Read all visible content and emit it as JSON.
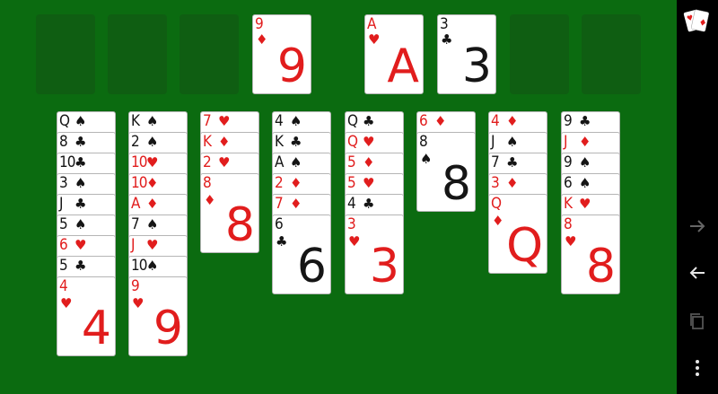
{
  "board": {
    "free_cells": 4,
    "foundations": [
      {
        "rank": "A",
        "suit": "♥",
        "color": "red"
      },
      {
        "rank": "3",
        "suit": "♣",
        "color": "black"
      }
    ],
    "top_card": {
      "rank": "9",
      "suit": "♦",
      "color": "red"
    },
    "tableau": [
      [
        {
          "rank": "Q",
          "suit": "♠",
          "color": "black"
        },
        {
          "rank": "8",
          "suit": "♣",
          "color": "black"
        },
        {
          "rank": "10",
          "suit": "♣",
          "color": "black"
        },
        {
          "rank": "3",
          "suit": "♠",
          "color": "black"
        },
        {
          "rank": "J",
          "suit": "♣",
          "color": "black"
        },
        {
          "rank": "5",
          "suit": "♠",
          "color": "black"
        },
        {
          "rank": "6",
          "suit": "♥",
          "color": "red"
        },
        {
          "rank": "5",
          "suit": "♣",
          "color": "black"
        },
        {
          "rank": "4",
          "suit": "♥",
          "color": "red"
        }
      ],
      [
        {
          "rank": "K",
          "suit": "♠",
          "color": "black"
        },
        {
          "rank": "2",
          "suit": "♠",
          "color": "black"
        },
        {
          "rank": "10",
          "suit": "♥",
          "color": "red"
        },
        {
          "rank": "10",
          "suit": "♦",
          "color": "red"
        },
        {
          "rank": "A",
          "suit": "♦",
          "color": "red"
        },
        {
          "rank": "7",
          "suit": "♠",
          "color": "black"
        },
        {
          "rank": "J",
          "suit": "♥",
          "color": "red"
        },
        {
          "rank": "10",
          "suit": "♠",
          "color": "black"
        },
        {
          "rank": "9",
          "suit": "♥",
          "color": "red"
        }
      ],
      [
        {
          "rank": "7",
          "suit": "♥",
          "color": "red"
        },
        {
          "rank": "K",
          "suit": "♦",
          "color": "red"
        },
        {
          "rank": "2",
          "suit": "♥",
          "color": "red"
        },
        {
          "rank": "8",
          "suit": "♦",
          "color": "red"
        }
      ],
      [
        {
          "rank": "4",
          "suit": "♠",
          "color": "black"
        },
        {
          "rank": "K",
          "suit": "♣",
          "color": "black"
        },
        {
          "rank": "A",
          "suit": "♠",
          "color": "black"
        },
        {
          "rank": "2",
          "suit": "♦",
          "color": "red"
        },
        {
          "rank": "7",
          "suit": "♦",
          "color": "red"
        },
        {
          "rank": "6",
          "suit": "♣",
          "color": "black"
        }
      ],
      [
        {
          "rank": "Q",
          "suit": "♣",
          "color": "black"
        },
        {
          "rank": "Q",
          "suit": "♥",
          "color": "red"
        },
        {
          "rank": "5",
          "suit": "♦",
          "color": "red"
        },
        {
          "rank": "5",
          "suit": "♥",
          "color": "red"
        },
        {
          "rank": "4",
          "suit": "♣",
          "color": "black"
        },
        {
          "rank": "3",
          "suit": "♥",
          "color": "red"
        }
      ],
      [
        {
          "rank": "6",
          "suit": "♦",
          "color": "red"
        },
        {
          "rank": "8",
          "suit": "♠",
          "color": "black"
        }
      ],
      [
        {
          "rank": "4",
          "suit": "♦",
          "color": "red"
        },
        {
          "rank": "J",
          "suit": "♠",
          "color": "black"
        },
        {
          "rank": "7",
          "suit": "♣",
          "color": "black"
        },
        {
          "rank": "3",
          "suit": "♦",
          "color": "red"
        },
        {
          "rank": "Q",
          "suit": "♦",
          "color": "red"
        }
      ],
      [
        {
          "rank": "9",
          "suit": "♣",
          "color": "black"
        },
        {
          "rank": "J",
          "suit": "♦",
          "color": "red"
        },
        {
          "rank": "9",
          "suit": "♠",
          "color": "black"
        },
        {
          "rank": "6",
          "suit": "♠",
          "color": "black"
        },
        {
          "rank": "K",
          "suit": "♥",
          "color": "red"
        },
        {
          "rank": "8",
          "suit": "♥",
          "color": "red"
        }
      ]
    ]
  },
  "navbar": {
    "icons": [
      "cards-app-icon",
      "forward-arrow-icon",
      "back-arrow-icon",
      "recent-apps-icon",
      "menu-dots-icon"
    ]
  },
  "colors": {
    "felt": "#0b6b10",
    "slot": "#0f5e12",
    "red": "#e11d1d",
    "black": "#151515"
  }
}
